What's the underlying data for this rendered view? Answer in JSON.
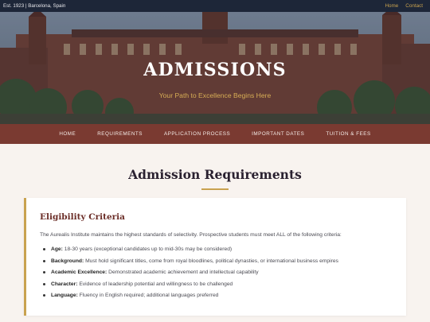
{
  "topbar": {
    "established": "Est. 1923 | Barcelona, Spain",
    "links": [
      "Home",
      "Contact"
    ],
    "link_color": "#c9a24f"
  },
  "hero": {
    "title": "ADMISSIONS",
    "tagline": "Your Path to Excellence Begins Here"
  },
  "nav": {
    "items": [
      "HOME",
      "REQUIREMENTS",
      "APPLICATION PROCESS",
      "IMPORTANT DATES",
      "TUITION & FEES"
    ],
    "background": "#7a3a31"
  },
  "section": {
    "title": "Admission Requirements"
  },
  "card": {
    "title": "Eligibility Criteria",
    "intro": "The Aurealis Institute maintains the highest standards of selectivity. Prospective students must meet ALL of the following criteria:",
    "criteria": [
      {
        "label": "Age:",
        "text": "18-30 years (exceptional candidates up to mid-30s may be considered)"
      },
      {
        "label": "Background:",
        "text": "Must hold significant titles, come from royal bloodlines, political dynasties, or international business empires"
      },
      {
        "label": "Academic Excellence:",
        "text": "Demonstrated academic achievement and intellectual capability"
      },
      {
        "label": "Character:",
        "text": "Evidence of leadership potential and willingness to be challenged"
      },
      {
        "label": "Language:",
        "text": "Fluency in English required; additional languages preferred"
      }
    ],
    "accent": "#c9a24f"
  }
}
